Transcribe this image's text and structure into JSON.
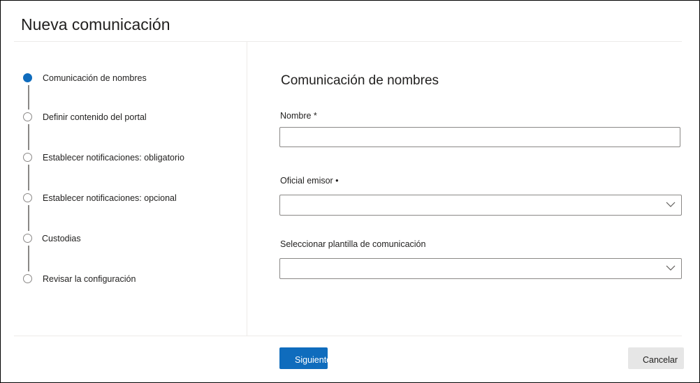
{
  "dialog": {
    "title": "Nueva comunicación"
  },
  "steps": [
    {
      "label": "Comunicación de nombres",
      "active": true
    },
    {
      "label": "Definir contenido del portal",
      "active": false
    },
    {
      "label": "Establecer notificaciones: obligatorio",
      "active": false
    },
    {
      "label": "Establecer notificaciones: opcional",
      "active": false
    },
    {
      "label": "Custodias",
      "active": false
    },
    {
      "label": "Revisar la configuración",
      "active": false
    }
  ],
  "form": {
    "section_title": "Comunicación de nombres",
    "name_label": "Nombre *",
    "name_value": "",
    "officer_label": "Oficial emisor •",
    "officer_value": "",
    "template_label": "Seleccionar plantilla de comunicación",
    "template_value": ""
  },
  "footer": {
    "next_label": "Siguiente",
    "cancel_label": "Cancelar"
  },
  "colors": {
    "accent": "#0f6cbd",
    "step_inactive": "#8a8886",
    "divider": "#edebe9"
  },
  "icons": {
    "active_step": "filled-circle-icon",
    "inactive_step": "empty-circle-icon",
    "dropdown": "chevron-down-icon"
  }
}
